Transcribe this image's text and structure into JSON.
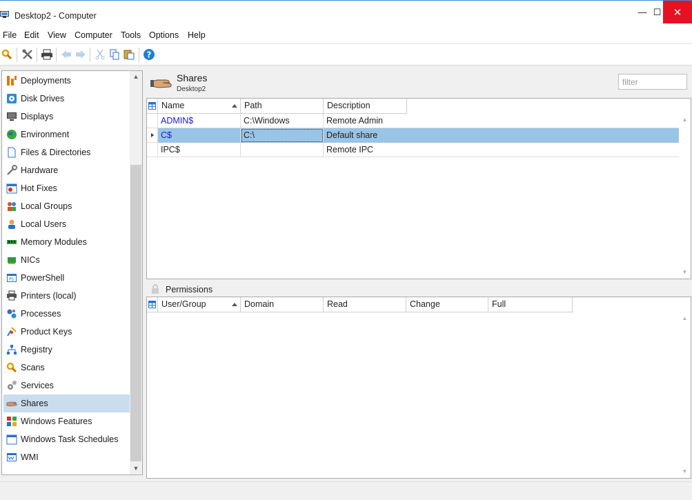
{
  "window": {
    "title": "Desktop2 - Computer",
    "min_glyph": "—",
    "max_glyph": "☐",
    "close_glyph": "✕"
  },
  "menu": [
    "File",
    "Edit",
    "View",
    "Computer",
    "Tools",
    "Options",
    "Help"
  ],
  "toolbar": {
    "icons": [
      "scan-icon",
      "settings-tools-icon",
      "print-icon",
      "back-icon",
      "forward-icon",
      "cut-icon",
      "copy-icon",
      "paste-icon",
      "help-icon"
    ]
  },
  "nav": {
    "items": [
      {
        "label": "Deployments",
        "icon": "deployments-icon"
      },
      {
        "label": "Disk Drives",
        "icon": "disk-drives-icon"
      },
      {
        "label": "Displays",
        "icon": "displays-icon"
      },
      {
        "label": "Environment",
        "icon": "environment-icon"
      },
      {
        "label": "Files & Directories",
        "icon": "files-icon"
      },
      {
        "label": "Hardware",
        "icon": "hardware-icon"
      },
      {
        "label": "Hot Fixes",
        "icon": "hot-fixes-icon"
      },
      {
        "label": "Local Groups",
        "icon": "local-groups-icon"
      },
      {
        "label": "Local Users",
        "icon": "local-users-icon"
      },
      {
        "label": "Memory Modules",
        "icon": "memory-icon"
      },
      {
        "label": "NICs",
        "icon": "nic-icon"
      },
      {
        "label": "PowerShell",
        "icon": "powershell-icon"
      },
      {
        "label": "Printers (local)",
        "icon": "printer-icon"
      },
      {
        "label": "Processes",
        "icon": "processes-icon"
      },
      {
        "label": "Product Keys",
        "icon": "product-keys-icon"
      },
      {
        "label": "Registry",
        "icon": "registry-icon"
      },
      {
        "label": "Scans",
        "icon": "scans-icon"
      },
      {
        "label": "Services",
        "icon": "services-icon"
      },
      {
        "label": "Shares",
        "icon": "shares-icon"
      },
      {
        "label": "Windows Features",
        "icon": "windows-features-icon"
      },
      {
        "label": "Windows Task Schedules",
        "icon": "task-schedules-icon"
      },
      {
        "label": "WMI",
        "icon": "wmi-icon"
      }
    ],
    "selected": "Shares"
  },
  "header": {
    "title": "Shares",
    "subtitle": "Desktop2",
    "filter_placeholder": "filter"
  },
  "shares": {
    "columns": [
      "Name",
      "Path",
      "Description"
    ],
    "rows": [
      {
        "name": "ADMIN$",
        "path": "C:\\Windows",
        "description": "Remote Admin"
      },
      {
        "name": "C$",
        "path": "C:\\",
        "description": "Default share"
      },
      {
        "name": "IPC$",
        "path": "",
        "description": "Remote IPC"
      }
    ],
    "selected_row": "C$"
  },
  "permissions": {
    "label": "Permissions",
    "columns": [
      "User/Group",
      "Domain",
      "Read",
      "Change",
      "Full"
    ],
    "rows": []
  },
  "colors": {
    "selection": "#99c4e6",
    "nav_selection": "#c9ddef",
    "link": "#1a1adc",
    "close_button": "#e81123"
  }
}
